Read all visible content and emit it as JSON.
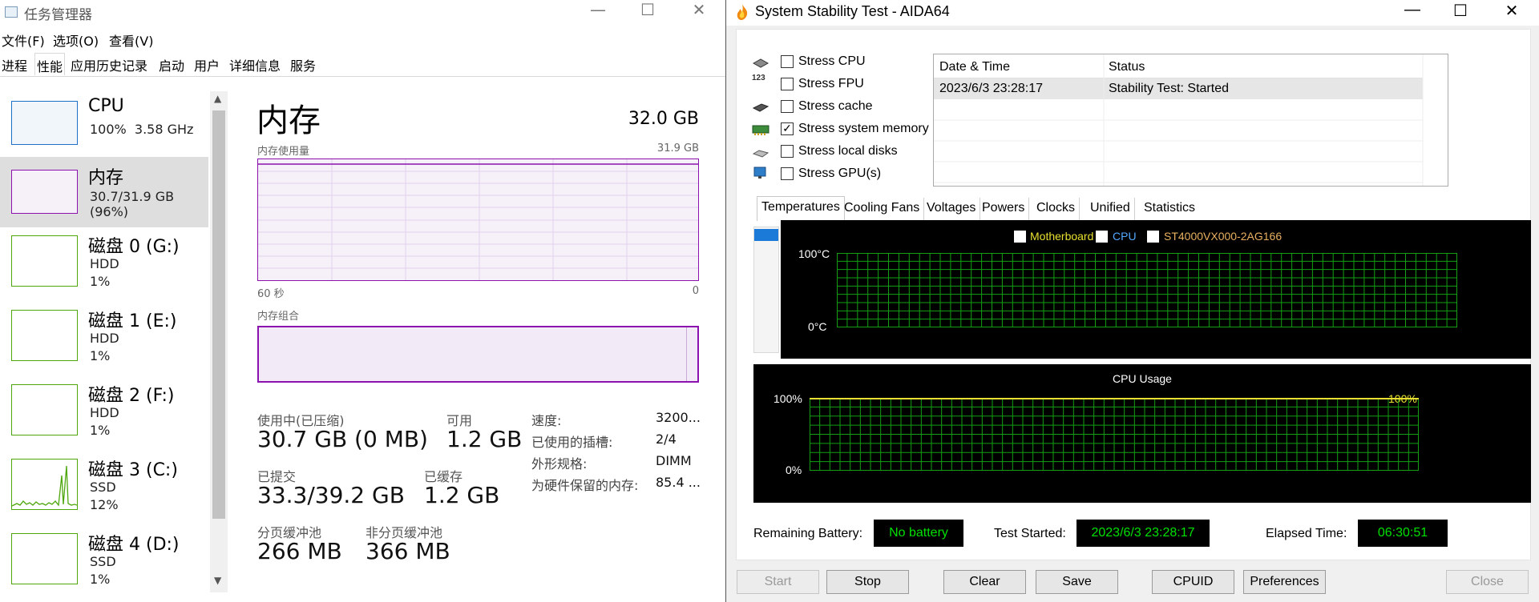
{
  "task_manager": {
    "window_title": "任务管理器",
    "menu": [
      "文件(F)",
      "选项(O)",
      "查看(V)"
    ],
    "tabs": [
      "进程",
      "性能",
      "应用历史记录",
      "启动",
      "用户",
      "详细信息",
      "服务"
    ],
    "sidebar": [
      {
        "title": "CPU",
        "sub1": "100%  3.58 GHz",
        "sub2": ""
      },
      {
        "title": "内存",
        "sub1": "30.7/31.9 GB (96%)",
        "sub2": ""
      },
      {
        "title": "磁盘 0 (G:)",
        "sub1": "HDD",
        "sub2": "1%"
      },
      {
        "title": "磁盘 1 (E:)",
        "sub1": "HDD",
        "sub2": "1%"
      },
      {
        "title": "磁盘 2 (F:)",
        "sub1": "HDD",
        "sub2": "1%"
      },
      {
        "title": "磁盘 3 (C:)",
        "sub1": "SSD",
        "sub2": "12%"
      },
      {
        "title": "磁盘 4 (D:)",
        "sub1": "SSD",
        "sub2": "1%"
      }
    ],
    "memory": {
      "title": "内存",
      "total": "32.0 GB",
      "usage_label": "内存使用量",
      "usage_max": "31.9 GB",
      "time_left": "60 秒",
      "time_right": "0",
      "composition_label": "内存组合",
      "in_use_label": "使用中(已压缩)",
      "in_use_value": "30.7 GB (0 MB)",
      "available_label": "可用",
      "available_value": "1.2 GB",
      "committed_label": "已提交",
      "committed_value": "33.3/39.2 GB",
      "cached_label": "已缓存",
      "cached_value": "1.2 GB",
      "paged_label": "分页缓冲池",
      "paged_value": "266 MB",
      "nonpaged_label": "非分页缓冲池",
      "nonpaged_value": "366 MB",
      "speed_label": "速度:",
      "speed_value": "3200...",
      "slots_label": "已使用的插槽:",
      "slots_value": "2/4",
      "form_label": "外形规格:",
      "form_value": "DIMM",
      "reserved_label": "为硬件保留的内存:",
      "reserved_value": "85.4 ..."
    },
    "colors": {
      "memory": "#8b12ae",
      "cpu": "#1e6fc8",
      "disk": "#4da60c"
    }
  },
  "aida": {
    "window_title": "System Stability Test - AIDA64",
    "stress_options": [
      {
        "label": "Stress CPU",
        "checked": false,
        "icon": "cpu-chip-icon"
      },
      {
        "label": "Stress FPU",
        "checked": false,
        "icon": "fpu-123-icon"
      },
      {
        "label": "Stress cache",
        "checked": false,
        "icon": "cache-chip-icon"
      },
      {
        "label": "Stress system memory",
        "checked": true,
        "icon": "memory-module-icon"
      },
      {
        "label": "Stress local disks",
        "checked": false,
        "icon": "disk-drive-icon"
      },
      {
        "label": "Stress GPU(s)",
        "checked": false,
        "icon": "gpu-monitor-icon"
      }
    ],
    "log_headers": [
      "Date & Time",
      "Status"
    ],
    "log_rows": [
      {
        "datetime": "2023/6/3 23:28:17",
        "status": "Stability Test: Started"
      }
    ],
    "tabs": [
      "Temperatures",
      "Cooling Fans",
      "Voltages",
      "Powers",
      "Clocks",
      "Unified",
      "Statistics"
    ],
    "temp_legend": [
      "Motherboard",
      "CPU",
      "ST4000VX000-2AG166"
    ],
    "temp_ymax": "100°C",
    "temp_ymin": "0°C",
    "cpu_title": "CPU Usage",
    "cpu_ymax": "100%",
    "cpu_ymin": "0%",
    "cpu_current": "100%",
    "remaining_battery_label": "Remaining Battery:",
    "remaining_battery_value": "No battery",
    "test_started_label": "Test Started:",
    "test_started_value": "2023/6/3 23:28:17",
    "elapsed_label": "Elapsed Time:",
    "elapsed_value": "06:30:51",
    "buttons": {
      "start": "Start",
      "stop": "Stop",
      "clear": "Clear",
      "save": "Save",
      "cpuid": "CPUID",
      "preferences": "Preferences",
      "close": "Close"
    },
    "colors": {
      "grid": "#12a012",
      "legend_text": "#e8e030",
      "cpu_line": "#e8e030",
      "value_text": "#00e000"
    }
  }
}
